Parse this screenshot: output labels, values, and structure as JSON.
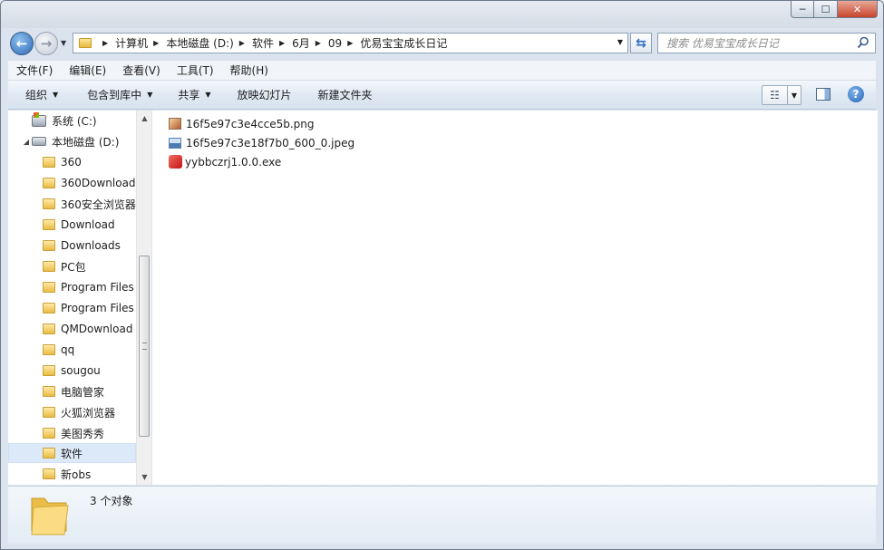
{
  "window": {
    "minimize_glyph": "─",
    "maximize_glyph": "☐",
    "close_glyph": "✕"
  },
  "address": {
    "breadcrumbs": [
      "计算机",
      "本地磁盘 (D:)",
      "软件",
      "6月",
      "09",
      "优易宝宝成长日记"
    ],
    "search_placeholder": "搜索 优易宝宝成长日记"
  },
  "menu": [
    "文件(F)",
    "编辑(E)",
    "查看(V)",
    "工具(T)",
    "帮助(H)"
  ],
  "toolbar": {
    "organize": "组织",
    "include_in_library": "包含到库中",
    "share": "共享",
    "slideshow": "放映幻灯片",
    "new_folder": "新建文件夹",
    "help_glyph": "?"
  },
  "nav_tree": [
    {
      "label": "系统 (C:)",
      "icon": "system-drive-icon",
      "level": 0
    },
    {
      "label": "本地磁盘 (D:)",
      "icon": "drive-icon",
      "level": 0,
      "expanded": true
    },
    {
      "label": "360",
      "icon": "folder-icon",
      "level": 1
    },
    {
      "label": "360Download",
      "icon": "folder-icon",
      "level": 1
    },
    {
      "label": "360安全浏览器",
      "icon": "folder-icon",
      "level": 1
    },
    {
      "label": "Download",
      "icon": "folder-icon",
      "level": 1
    },
    {
      "label": "Downloads",
      "icon": "folder-icon",
      "level": 1
    },
    {
      "label": "PC包",
      "icon": "folder-icon",
      "level": 1
    },
    {
      "label": "Program Files",
      "icon": "folder-icon",
      "level": 1
    },
    {
      "label": "Program Files",
      "icon": "folder-icon",
      "level": 1
    },
    {
      "label": "QMDownload",
      "icon": "folder-icon",
      "level": 1
    },
    {
      "label": "qq",
      "icon": "folder-icon",
      "level": 1
    },
    {
      "label": "sougou",
      "icon": "folder-icon",
      "level": 1
    },
    {
      "label": "电脑管家",
      "icon": "folder-icon",
      "level": 1
    },
    {
      "label": "火狐浏览器",
      "icon": "folder-icon",
      "level": 1
    },
    {
      "label": "美图秀秀",
      "icon": "folder-icon",
      "level": 1
    },
    {
      "label": "软件",
      "icon": "folder-icon",
      "level": 1,
      "selected": true
    },
    {
      "label": "新obs",
      "icon": "folder-icon",
      "level": 1
    }
  ],
  "files": [
    {
      "name": "16f5e97c3e4cce5b.png",
      "icon": "png-file-icon"
    },
    {
      "name": "16f5e97c3e18f7b0_600_0.jpeg",
      "icon": "jpeg-file-icon"
    },
    {
      "name": "yybbczrj1.0.0.exe",
      "icon": "exe-file-icon"
    }
  ],
  "status": {
    "item_count": "3 个对象"
  }
}
